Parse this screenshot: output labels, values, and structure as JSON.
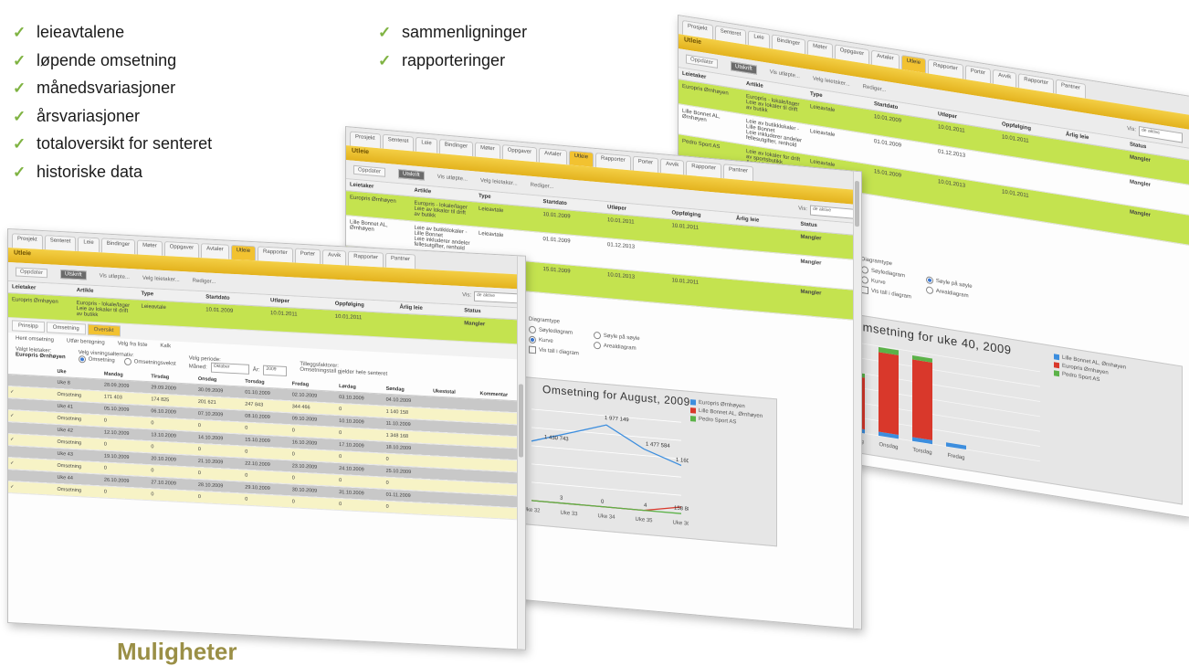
{
  "bullets_left": [
    "leieavtalene",
    "løpende omsetning",
    "månedsvariasjoner",
    "årsvariasjoner",
    "totaloversikt for senteret",
    "historiske data"
  ],
  "bullets_right": [
    "sammenligninger",
    "rapporteringer"
  ],
  "check_glyph": "✓",
  "heading": "Muligheter",
  "colors": {
    "heading": "#9a8f46",
    "check": "#7fb342",
    "accent_yellow": "#f2c230",
    "row_highlight": "#c4e34f",
    "status_red": "#d52b1e",
    "series_blue": "#3d8ede",
    "series_red": "#d9382b",
    "series_green": "#5bb248"
  },
  "app": {
    "tabs": [
      "Prosjekt",
      "Senteret",
      "Leie",
      "Bindinger",
      "Møter",
      "Oppgaver",
      "Avtaler",
      "Utleie",
      "Rapporter",
      "Porter",
      "Avvik",
      "Rapporter",
      "Pantner"
    ],
    "active_tab": "Utleie",
    "section_title": "Utleie",
    "toolbar": {
      "btn1": "Oppdater",
      "btn2": "Utskrift",
      "filter1": "Vis utløpte...",
      "filter2": "Velg leietaker...",
      "filter3": "Rediger...",
      "vis_label": "Vis:",
      "vis_value": "de aktive"
    },
    "columns": [
      "Leietaker",
      "Artikle",
      "Type",
      "Startdato",
      "Utløper",
      "Oppfølging",
      "Årlig leie",
      "Status"
    ],
    "rows": [
      {
        "tenant": "Europris Ørnhøyen",
        "article": "Europris - lokale/lager",
        "article2": "Leie av lokaler til drift av butikk",
        "type": "Leieavtale",
        "start": "10.01.2009",
        "end": "10.01.2011",
        "follow": "10.01.2011",
        "status": "Mangler"
      },
      {
        "tenant": "Lille Bonnet AL, Ørnhøyen",
        "article": "Leie av butikklokaler - Lille Bonnet",
        "article2": "Leie inkluderer andeler fellesutgifter, renhold",
        "type": "Leieavtale",
        "start": "01.01.2009",
        "end": "01.12.2013",
        "follow": "",
        "status": "Mangler"
      },
      {
        "tenant": "Pedro Sport AS",
        "article": "Leie av lokaler for drift av sportsbutikk",
        "article2": "Andel fellesarealer og parkering",
        "type": "Leieavtale",
        "start": "15.01.2009",
        "end": "10.01.2013",
        "follow": "10.01.2011",
        "status": "Mangler"
      }
    ]
  },
  "chart_options": {
    "heading": "Diagramtype",
    "radio_bar": "Søylediagram",
    "radio_line": "Kurve",
    "radio_stacked": "Søyle på søyle",
    "radio_area": "Arealdiagram",
    "checkbox": "Vis tall i diagram"
  },
  "chart_data": [
    {
      "type": "line",
      "title": "Omsetning for August, 2009",
      "x": [
        "Uke 32",
        "Uke 33",
        "Uke 34",
        "Uke 35",
        "Uke 36"
      ],
      "series": [
        {
          "name": "Europris Ørnhøyen",
          "color": "#3d8ede",
          "values": [
            1430743,
            1700000,
            1977000,
            1477584,
            1160000
          ]
        },
        {
          "name": "Lille Bonnet AL, Ørnhøyen",
          "color": "#d9382b",
          "values": [
            0,
            0,
            0,
            0,
            158887
          ]
        },
        {
          "name": "Pedro Sport AS",
          "color": "#5bb248",
          "values": [
            0,
            0,
            0,
            0,
            0
          ]
        }
      ],
      "data_labels": [
        "1 430 743",
        "1 977 149",
        "1 477 584",
        "1 160 708",
        "3",
        "0",
        "4",
        "158 887"
      ]
    },
    {
      "type": "bar",
      "stacked": true,
      "title": "Omsetning for uke 40, 2009",
      "categories": [
        "Mandag",
        "Tirsdag",
        "Onsdag",
        "Torsdag",
        "Fredag",
        "Lørdag",
        "Søndag"
      ],
      "series": [
        {
          "name": "Lille Bonnet AL, Ørnhøyen",
          "color": "#3d8ede",
          "values": [
            4,
            4,
            4,
            4,
            4,
            0,
            0
          ]
        },
        {
          "name": "Europris Ørnhøyen",
          "color": "#d9382b",
          "values": [
            58,
            52,
            80,
            78,
            0,
            0,
            0
          ]
        },
        {
          "name": "Pedro Sport AS",
          "color": "#5bb248",
          "values": [
            4,
            4,
            5,
            4,
            0,
            0,
            0
          ]
        }
      ],
      "x_labels_visible": [
        "Mandag",
        "Tirsdag",
        "Onsdag",
        "Torsdag",
        "Fredag"
      ]
    }
  ],
  "detail": {
    "subtabs": [
      "Prinsipp",
      "Omsetning",
      "Oversikt"
    ],
    "active_subtab": "Oversikt",
    "sub_actions": [
      "Hent omsetning",
      "Utfør beregning",
      "Velg fra liste",
      "Kalk"
    ],
    "tenant_label": "Valgt leietaker:",
    "tenant_value": "Europris Ørnhøyen",
    "group_label": "Velg visningsalternativ:",
    "radio1": "Omsetning",
    "radio2": "Omsetningsvekst",
    "period_label": "Velg periode:",
    "month_label": "Måned:",
    "month_value": "Oktober",
    "year_label": "År:",
    "year_value": "2009",
    "totals_label": "Tilleggsfaktorer:",
    "totals_value": "Omsetningstall gjelder hele senteret",
    "week_columns": [
      "",
      "Uke",
      "Mandag",
      "Tirsdag",
      "Onsdag",
      "Torsdag",
      "Fredag",
      "Lørdag",
      "Søndag",
      "Ukestotal",
      "Kommentar"
    ],
    "week_rows": [
      {
        "c": [
          "",
          "Uke 8",
          "28.09.2009",
          "29.09.2009",
          "30.09.2009",
          "01.10.2009",
          "02.10.2009",
          "03.10.2009",
          "04.10.2009",
          "",
          ""
        ],
        "style": "sum"
      },
      {
        "c": [
          "✓",
          "Omsetning",
          "171 403",
          "174 825",
          "201 621",
          "247 843",
          "344 466",
          "0",
          "1 140 158",
          "",
          ""
        ],
        "style": "alt"
      },
      {
        "c": [
          "",
          "Uke 41",
          "05.10.2009",
          "06.10.2009",
          "07.10.2009",
          "08.10.2009",
          "09.10.2009",
          "10.10.2009",
          "11.10.2009",
          "",
          ""
        ],
        "style": "sum"
      },
      {
        "c": [
          "✓",
          "Omsetning",
          "0",
          "0",
          "0",
          "0",
          "0",
          "0",
          "1 348 168",
          "",
          ""
        ],
        "style": "alt"
      },
      {
        "c": [
          "",
          "Uke 42",
          "12.10.2009",
          "13.10.2009",
          "14.10.2009",
          "15.10.2009",
          "16.10.2009",
          "17.10.2009",
          "18.10.2009",
          "",
          ""
        ],
        "style": "sum"
      },
      {
        "c": [
          "✓",
          "Omsetning",
          "0",
          "0",
          "0",
          "0",
          "0",
          "0",
          "0",
          "",
          ""
        ],
        "style": "alt"
      },
      {
        "c": [
          "",
          "Uke 43",
          "19.10.2009",
          "20.10.2009",
          "21.10.2009",
          "22.10.2009",
          "23.10.2009",
          "24.10.2009",
          "25.10.2009",
          "",
          ""
        ],
        "style": "sum"
      },
      {
        "c": [
          "✓",
          "Omsetning",
          "0",
          "0",
          "0",
          "0",
          "0",
          "0",
          "0",
          "",
          ""
        ],
        "style": "alt"
      },
      {
        "c": [
          "",
          "Uke 44",
          "26.10.2009",
          "27.10.2009",
          "28.10.2009",
          "29.10.2009",
          "30.10.2009",
          "31.10.2009",
          "01.11.2009",
          "",
          ""
        ],
        "style": "sum"
      },
      {
        "c": [
          "✓",
          "Omsetning",
          "0",
          "0",
          "0",
          "0",
          "0",
          "0",
          "0",
          "",
          ""
        ],
        "style": "alt"
      }
    ]
  }
}
